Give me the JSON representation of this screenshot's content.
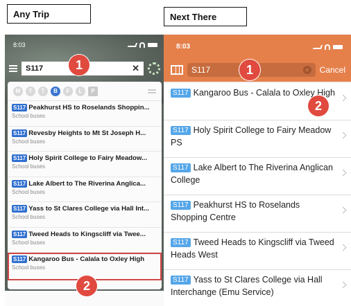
{
  "left_app": {
    "title": "Any Trip",
    "status_time": "8:03",
    "search_value": "S117",
    "modes": [
      "M",
      "T",
      "T",
      "B",
      "F",
      "L",
      "P"
    ],
    "results": [
      {
        "badge": "S117",
        "title": "Peakhurst HS to Roselands Shoppin...",
        "subtitle": "School buses"
      },
      {
        "badge": "S117",
        "title": "Revesby Heights to Mt St Joseph H...",
        "subtitle": "School buses"
      },
      {
        "badge": "S117",
        "title": "Holy Spirit College to Fairy Meadow...",
        "subtitle": "School buses"
      },
      {
        "badge": "S117",
        "title": "Lake Albert to The Riverina Anglica...",
        "subtitle": "School buses"
      },
      {
        "badge": "S117",
        "title": "Yass to St Clares College via Hall Int...",
        "subtitle": "School buses"
      },
      {
        "badge": "S117",
        "title": "Tweed Heads to Kingscliff via Twee...",
        "subtitle": "School buses"
      },
      {
        "badge": "S117",
        "title": "Kangaroo Bus - Calala to Oxley High",
        "subtitle": "School buses"
      }
    ]
  },
  "right_app": {
    "title": "Next There",
    "status_time": "8:03",
    "search_value": "S117",
    "cancel_label": "Cancel",
    "results": [
      {
        "badge": "S117",
        "title": "Kangaroo Bus - Calala to Oxley High"
      },
      {
        "badge": "S117",
        "title": "Holy Spirit College to Fairy Meadow PS"
      },
      {
        "badge": "S117",
        "title": "Lake Albert to The Riverina Anglican College"
      },
      {
        "badge": "S117",
        "title": "Peakhurst HS to Roselands Shopping Centre"
      },
      {
        "badge": "S117",
        "title": "Tweed Heads to Kingscliff via Tweed Heads West"
      },
      {
        "badge": "S117",
        "title": "Yass to St Clares College via Hall Interchange (Emu Service)"
      }
    ]
  },
  "markers": {
    "left_search": "1",
    "left_result": "2",
    "right_search": "1",
    "right_result": "2"
  },
  "colors": {
    "marker": "#e04a3f",
    "right_header": "#e5804b",
    "left_badge": "#2f6fd0",
    "right_badge": "#55a6e8",
    "highlight_border": "#d24747"
  }
}
